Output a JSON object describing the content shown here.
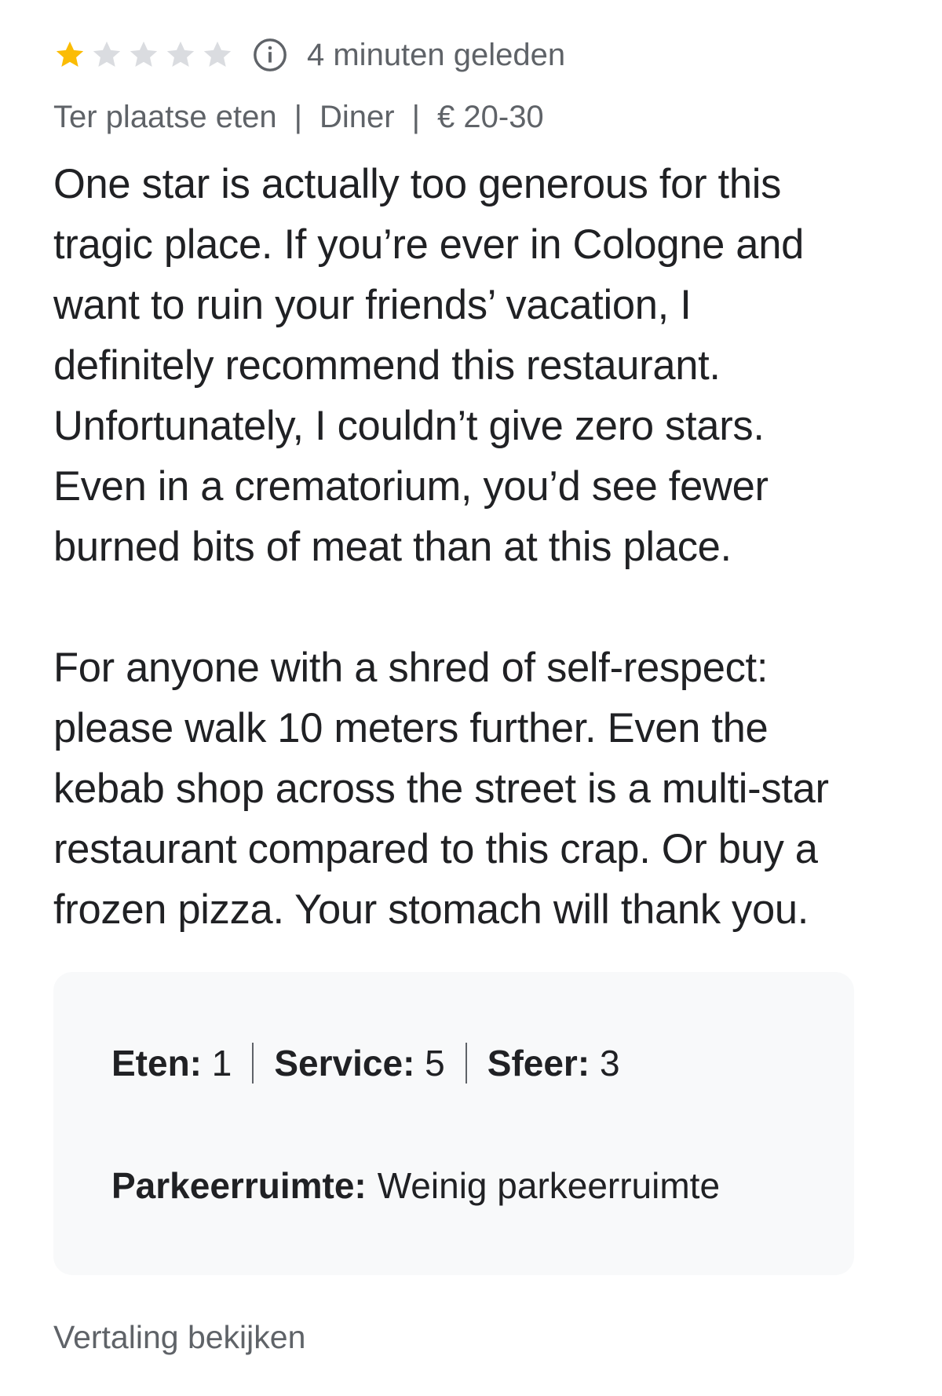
{
  "review": {
    "rating": 1,
    "max_rating": 5,
    "star_filled_color": "#fbbc04",
    "star_empty_color": "#dadce0",
    "info_icon": "info-icon",
    "time_ago": "4 minuten geleden",
    "tags": [
      "Ter plaatse eten",
      "Diner",
      "€ 20-30"
    ],
    "tag_separator": "|",
    "paragraphs": [
      "One star is actually too generous for this\ntragic place. If you’re ever in Cologne and\nwant to ruin your friends’ vacation, I\ndefinitely recommend this restaurant.\nUnfortunately, I couldn’t give zero stars.\nEven in a crematorium, you’d see fewer\nburned bits of meat than at this place.",
      "For anyone with a shred of self-respect:\nplease walk 10 meters further. Even the\nkebab shop across the street is a multi-star\nrestaurant compared to this crap. Or buy a\nfrozen pizza. Your stomach will thank you."
    ],
    "ratings": [
      {
        "label": "Eten:",
        "value": "1"
      },
      {
        "label": "Service:",
        "value": "5"
      },
      {
        "label": "Sfeer:",
        "value": "3"
      }
    ],
    "parking": {
      "label": "Parkeerruimte:",
      "value": "Weinig parkeerruimte"
    },
    "translate_label": "Vertaling bekijken"
  }
}
